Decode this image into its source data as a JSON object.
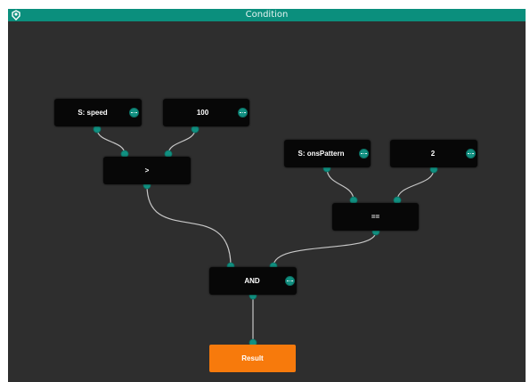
{
  "window": {
    "title": "Condition",
    "accent_color": "#0b8f7d",
    "canvas_color": "#2e2e2e",
    "app_icon": "app-logo-icon"
  },
  "nodes": {
    "speed": {
      "label": "S: speed",
      "menu_icon": "more-options-icon"
    },
    "hundred": {
      "label": "100",
      "menu_icon": "more-options-icon"
    },
    "greater": {
      "label": ">"
    },
    "pattern": {
      "label": "S: onsPattern",
      "menu_icon": "more-options-icon"
    },
    "two": {
      "label": "2",
      "menu_icon": "more-options-icon"
    },
    "equals": {
      "label": "=="
    },
    "and": {
      "label": "AND",
      "menu_icon": "more-options-icon"
    },
    "result": {
      "label": "Result",
      "color": "#f77a0c"
    }
  },
  "colors": {
    "node_bg": "#070707",
    "port": "#119081",
    "wire": "#c8c8c8"
  }
}
